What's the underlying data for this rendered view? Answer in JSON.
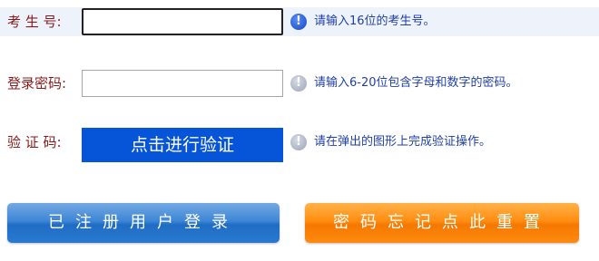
{
  "form": {
    "exam_id": {
      "label": "考 生 号:",
      "value": "",
      "hint": "请输入16位的考生号。"
    },
    "password": {
      "label": "登录密码:",
      "value": "",
      "hint": "请输入6-20位包含字母和数字的密码。"
    },
    "captcha": {
      "label": "验 证 码:",
      "button_label": "点击进行验证",
      "hint": "请在弹出的图形上完成验证操作。"
    }
  },
  "actions": {
    "registered_login": "已注册用户登录",
    "password_reset": "密码忘记点此重置"
  },
  "icons": {
    "hint_active": "info-icon",
    "hint_inactive": "info-icon"
  },
  "colors": {
    "label": "#8b1a1a",
    "hint": "#1f3fa8",
    "verify_button": "#0655d8",
    "login_button": "#2a7ad2",
    "reset_button": "#ff8a10",
    "active_row": "#eef3fb"
  }
}
